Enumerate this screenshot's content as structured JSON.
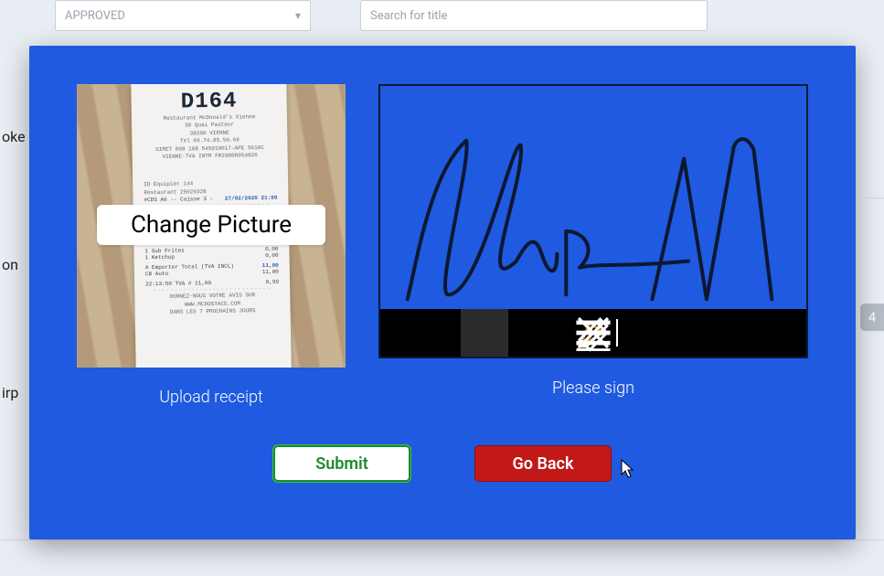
{
  "background": {
    "filter_status_value": "APPROVED",
    "search_placeholder": "Search for title",
    "side_fragments": [
      "oke",
      "on",
      "irp"
    ],
    "right_count": "4"
  },
  "modal": {
    "upload": {
      "change_button_label": "Change Picture",
      "caption": "Upload receipt",
      "receipt_header": "D164",
      "receipt_lines": {
        "r1": "Restaurant McDonald's Vienne",
        "r2": "30 Quai Pasteur",
        "r3": "38200 VIENNE",
        "r4": "Tel 04.74.85.50.69",
        "r5": "SIRET 808 108 545010017-APE 5610C",
        "r6": "VIENNE-TVA INTR FR29808954826",
        "mid1": "ID Équipier 144",
        "mid2": "Restaurant  25020328",
        "mid3_left": "#CDS  A6 -- Caisse 3 -",
        "mid3_right": "27/02/2020 21:09",
        "i1_left": "1 Sub Frites",
        "i1_right": "0,00",
        "i2_left": "1 Ketchup",
        "i2_right": "0,00",
        "tot_left": "A Emporter  Total (TVA INCL)",
        "tot_right": "11,00",
        "cb_left": "CB Auto",
        "cb_right": "11,00",
        "time_left": "22:13:50     TVA #    11,00",
        "time_right": "0,99",
        "foot1": "DONNEZ-NOUS VOTRE AVIS SUR",
        "foot2": "WWW.MCDOSTACE.COM",
        "foot3": "DANS LES 7 PROCHAINS JOURS",
        "dots": "····························"
      }
    },
    "sign": {
      "caption": "Please sign",
      "tools": [
        "pen",
        "eraser",
        "clear",
        "divider",
        "lines",
        "edit"
      ]
    },
    "actions": {
      "submit_label": "Submit",
      "goback_label": "Go Back"
    }
  }
}
